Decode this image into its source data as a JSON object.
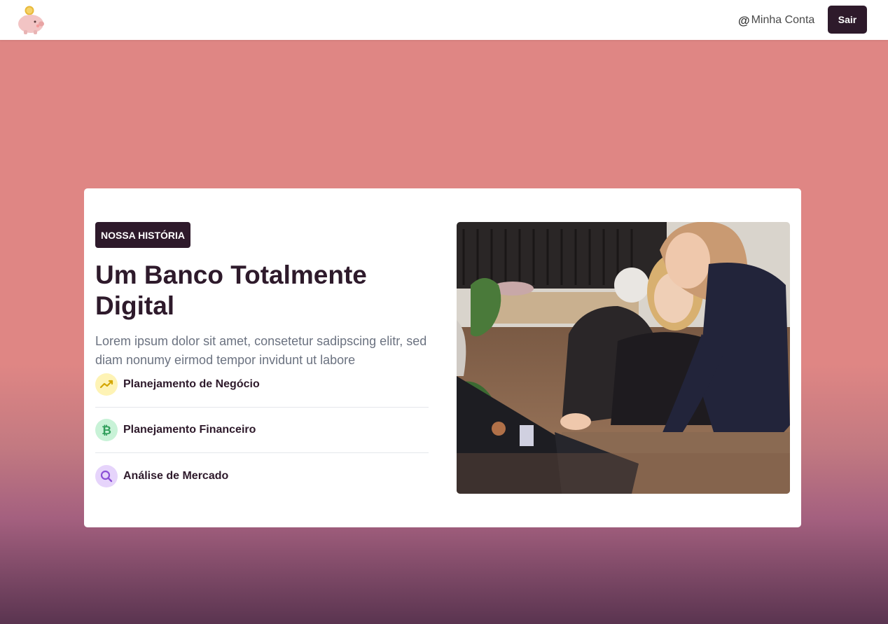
{
  "header": {
    "logo_icon": "piggy-bank-icon",
    "account_icon": "at-icon",
    "account_label": "Minha Conta",
    "logout_label": "Sair"
  },
  "hero": {
    "badge": "NOSSA HISTÓRIA",
    "title": "Um Banco Totalmente Digital",
    "description": "Lorem ipsum dolor sit amet, consetetur sadipscing elitr, sed diam nonumy eirmod tempor invidunt ut labore",
    "features": [
      {
        "icon": "trend-up-icon",
        "label": "Planejamento de Negócio",
        "color": "#d4a600"
      },
      {
        "icon": "bitcoin-icon",
        "label": "Planejamento Financeiro",
        "color": "#2f9e5a"
      },
      {
        "icon": "search-icon",
        "label": "Análise de Mercado",
        "color": "#8b4fd6"
      }
    ],
    "image_icon": "office-photo"
  },
  "colors": {
    "brand_dark": "#2e1a2b",
    "background_top": "#df8684",
    "background_bottom": "#5a3450"
  }
}
